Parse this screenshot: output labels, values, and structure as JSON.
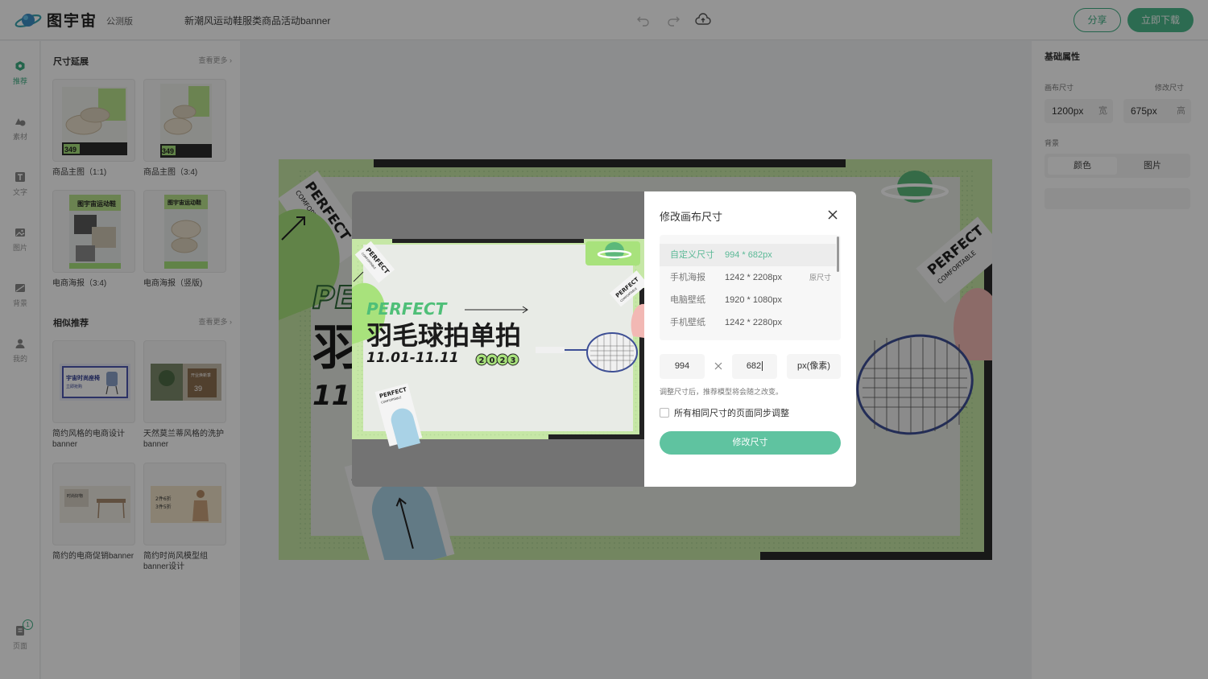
{
  "header": {
    "logo_text": "图宇宙",
    "beta_label": "公测版",
    "doc_title": "新潮风运动鞋服类商品活动banner",
    "share_label": "分享",
    "download_label": "立即下载"
  },
  "rail": {
    "items": [
      {
        "label": "推荐"
      },
      {
        "label": "素材"
      },
      {
        "label": "文字"
      },
      {
        "label": "图片"
      },
      {
        "label": "背景"
      },
      {
        "label": "我的"
      }
    ],
    "pages_label": "页面",
    "pages_count": "1"
  },
  "templates": {
    "size_section": {
      "title": "尺寸延展",
      "more": "查看更多",
      "cards": [
        {
          "label": "商品主图（1:1)",
          "price": "349"
        },
        {
          "label": "商品主图（3:4)",
          "price": "349"
        },
        {
          "label": "电商海报（3:4)",
          "headline": "图宇宙运动鞋"
        },
        {
          "label": "电商海报（竖版)",
          "headline": "图宇宙运动鞋"
        }
      ]
    },
    "similar_section": {
      "title": "相似推荐",
      "more": "查看更多",
      "cards": [
        {
          "label": "简约风格的电商设计banner",
          "headline": "宇宙时尚座椅",
          "sub": "立即抢购"
        },
        {
          "label": "天然莫兰蒂风格的洗护banner",
          "headline": "开业焕新季",
          "price": "39"
        },
        {
          "label": "简约的电商促销banner",
          "headline": "时尚好物"
        },
        {
          "label": "简约时尚风模型组banner设计",
          "headline": "2件6折",
          "sub": "3件5折"
        }
      ]
    }
  },
  "props": {
    "title": "基础属性",
    "canvas_size_label": "画布尺寸",
    "resize_link": "修改尺寸",
    "width_value": "1200px",
    "width_unit": "宽",
    "height_value": "675px",
    "height_unit": "高",
    "background_label": "背景",
    "bg_tabs": [
      "颜色",
      "图片"
    ]
  },
  "canvas": {
    "stamp_text": "PERFECT",
    "stamp_sub": "COMFORTABLE",
    "big_letters": "PE",
    "big_cn": "羽",
    "big_date": "11."
  },
  "dialog": {
    "title": "修改画布尺寸",
    "presets": [
      {
        "name": "自定义尺寸",
        "size": "994 * 682px",
        "tag": ""
      },
      {
        "name": "手机海报",
        "size": "1242 * 2208px",
        "tag": "原尺寸"
      },
      {
        "name": "电脑壁纸",
        "size": "1920 * 1080px",
        "tag": ""
      },
      {
        "name": "手机壁纸",
        "size": "1242 * 2280px",
        "tag": ""
      }
    ],
    "width_input": "994",
    "height_input": "682",
    "unit": "px(像素)",
    "hint": "调整尺寸后，推荐模型将会随之改变。",
    "sync_label": "所有相同尺寸的页面同步调整",
    "sync_checked": false,
    "apply_label": "修改尺寸",
    "preview": {
      "perfect": "PERFECT",
      "headline": "羽毛球拍单拍",
      "dates": "11.01-11.11",
      "year": [
        "2",
        "0",
        "2",
        "3"
      ],
      "stamp_text": "PERFECT",
      "stamp_sub": "COMFORTABLE"
    }
  },
  "colors": {
    "accent": "#4cb98c",
    "accent_light": "#5fc3a0",
    "banner_green": "#a8e27c",
    "dark": "#222222"
  }
}
